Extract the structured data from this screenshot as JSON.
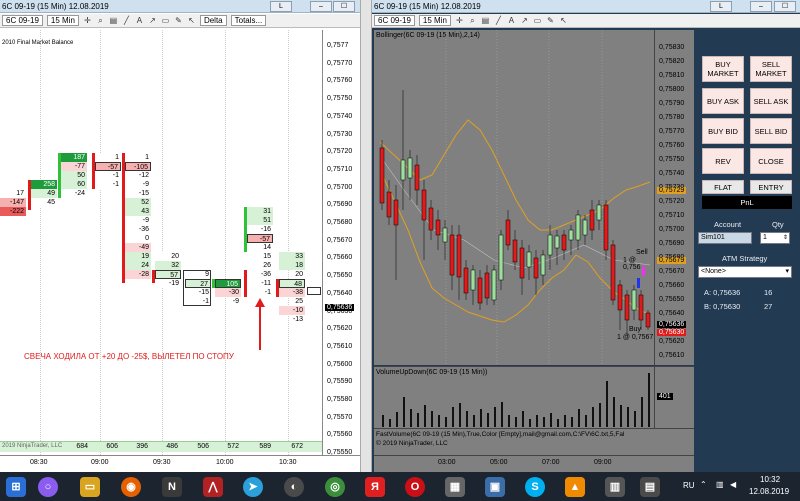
{
  "left": {
    "title": "6C 09-19 (15 Min)  12.08.2019",
    "toolbar": {
      "instrument": "6C 09-19",
      "interval": "15 Min",
      "indicator": "Delta",
      "totals": "Totals..."
    },
    "balance_label": "2010 Final Market Balance",
    "annotation": "СВЕЧА ХОДИЛА ОТ +20 ДО -25$, ВЫЛЕТЕЛ ПО СТОПУ",
    "price_axis": [
      "0,7577",
      "0,75770",
      "0,75760",
      "0,75750",
      "0,75740",
      "0,75730",
      "0,75720",
      "0,75710",
      "0,75700",
      "0,75690",
      "0,75680",
      "0,75670",
      "0,75660",
      "0,75650",
      "0,75640",
      "0,75630",
      "0,75620",
      "0,75610",
      "0,75600",
      "0,75590",
      "0,75580",
      "0,75570",
      "0,75560",
      "0,75550"
    ],
    "current_price": "0,75636",
    "time_labels": [
      "08:30",
      "09:00",
      "09:30",
      "10:00",
      "10:30"
    ],
    "footer_prefix": "2019 NinjaTrader, LLC",
    "totals_row": [
      "684",
      "606",
      "396",
      "486",
      "506",
      "572",
      "589",
      "672"
    ]
  },
  "right": {
    "title": "6C 09-19 (15 Min)  12.08.2019",
    "toolbar": {
      "instrument": "6C 09-19",
      "interval": "15 Min"
    },
    "indicator_label": "Bollinger(6C 09-19 (15 Min),2,14)",
    "price_axis": [
      "0,75830",
      "0,75820",
      "0,75810",
      "0,75800",
      "0,75790",
      "0,75780",
      "0,75770",
      "0,75760",
      "0,75750",
      "0,75740",
      "0,75730",
      "0,75720",
      "0,75710",
      "0,75700",
      "0,75690",
      "0,75680",
      "0,75670",
      "0,75660",
      "0,75650",
      "0,75640",
      "0,75630",
      "0,75620",
      "0,75610"
    ],
    "band_upper_price": "0,75729",
    "band_lower_price": "0,75679",
    "last_price": "0,75636",
    "last_price2": "0,75630",
    "sell_label": "Sell",
    "sell_price": "1 @ 0,756",
    "buy_label": "Buy",
    "buy_price": "1 @ 0,7567",
    "volume_label": "VolumeUpDown(6C 09-19 (15 Min))",
    "volume_value": "401",
    "footer_line1": "FastVolume(6C 09-19 (15 Min),True,Color [Empty],mail@gmail.com,C:\\FV\\6C.txt,5,Fal",
    "footer_line2": "© 2019 NinjaTrader, LLC",
    "time_labels": [
      "03:00",
      "05:00",
      "07:00",
      "09:00"
    ]
  },
  "panel": {
    "buttons": {
      "buy_market": "BUY\nMARKET",
      "sell_market": "SELL\nMARKET",
      "buy_ask": "BUY ASK",
      "sell_ask": "SELL ASK",
      "buy_bid": "BUY BID",
      "sell_bid": "SELL BID",
      "rev": "REV",
      "close": "CLOSE",
      "flat": "FLAT",
      "entry": "ENTRY",
      "pnl": "PnL"
    },
    "account_label": "Account",
    "qty_label": "Qty",
    "account_value": "Sim101",
    "qty_value": "1",
    "atm_label": "ATM Strategy",
    "atm_value": "<None>",
    "ask_label": "A: 0,75636",
    "ask_size": "16",
    "bid_label": "B: 0,75630",
    "bid_size": "27"
  },
  "taskbar": {
    "lang": "RU",
    "time": "10:32",
    "date": "12.08.2019"
  },
  "colors": {
    "bull": "#2ec23a",
    "bear": "#e11b1b",
    "band": "#e0a020",
    "chart_bg": "#808080",
    "panel_bg": "#223a52"
  }
}
